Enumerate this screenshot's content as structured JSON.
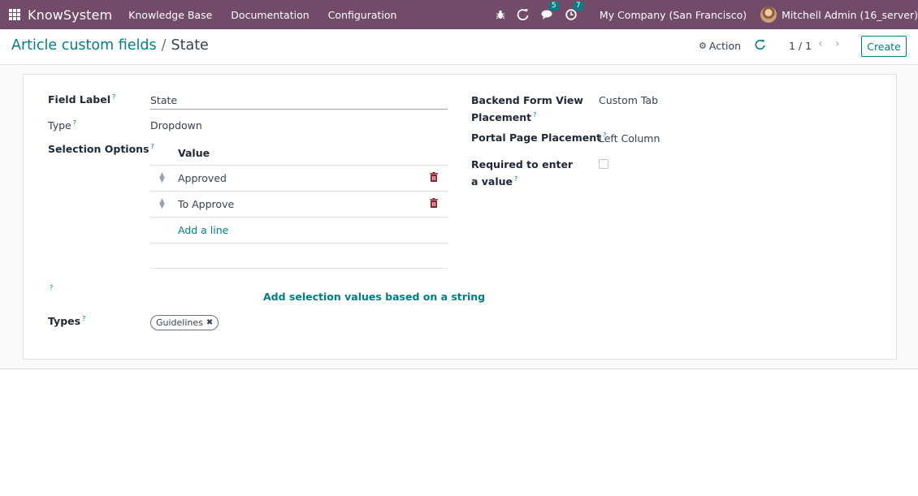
{
  "navbar": {
    "brand": "KnowSystem",
    "menu": [
      "Knowledge Base",
      "Documentation",
      "Configuration"
    ],
    "chat_count": "5",
    "activity_count": "7",
    "company": "My Company (San Francisco)",
    "user": "Mitchell Admin (16_server)",
    "icons": [
      "apps-grid-icon",
      "bug-icon",
      "refresh-icon",
      "chat-icon",
      "clock-icon"
    ]
  },
  "control": {
    "breadcrumb_parent": "Article custom fields",
    "breadcrumb_sep": "/",
    "breadcrumb_current": "State",
    "action_label": "Action",
    "pager": "1 / 1",
    "create_label": "Create"
  },
  "form": {
    "field_label_label": "Field Label",
    "field_label_value": "State",
    "type_label": "Type",
    "type_value": "Dropdown",
    "selection_label": "Selection Options",
    "selection_header": "Value",
    "selection_rows": [
      "Approved",
      "To Approve"
    ],
    "add_line": "Add a line",
    "help_only": "?",
    "add_string_button": "Add selection values based on a string",
    "types_label": "Types",
    "types_tags": [
      "Guidelines"
    ],
    "backend_label": "Backend Form View Placement",
    "backend_value": "Custom Tab",
    "portal_label": "Portal Page Placement",
    "portal_value": "Left Column",
    "required_label": "Required to enter a value",
    "required_value": false
  },
  "colors": {
    "navbar": "#714b67",
    "accent": "#017e84",
    "badge": "#017e84"
  }
}
